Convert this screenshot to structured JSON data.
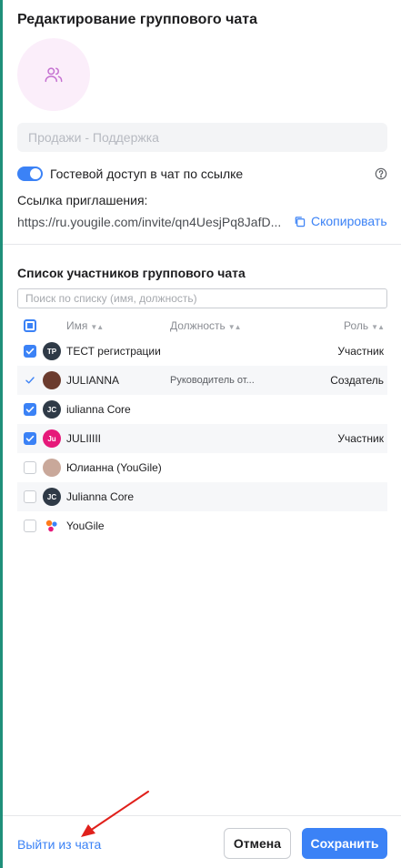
{
  "dialog": {
    "title": "Редактирование группового чата",
    "name_placeholder": "Продажи - Поддержка",
    "name_value": "",
    "guest_access_label": "Гостевой доступ в чат по ссылке",
    "guest_access_enabled": true,
    "invite_label": "Ссылка приглашения:",
    "invite_link": "https://ru.yougile.com/invite/qn4UesjPq8JafD...",
    "copy_label": "Скопировать"
  },
  "members": {
    "title": "Список участников группового чата",
    "search_placeholder": "Поиск по списку (имя, должность)",
    "columns": {
      "name": "Имя",
      "job": "Должность",
      "role": "Роль"
    },
    "rows": [
      {
        "check": "on",
        "avatar_text": "ТР",
        "avatar_color": "#2f3a47",
        "name": "ТЕСТ регистрации",
        "job": "",
        "role": "Участник"
      },
      {
        "check": "tick",
        "avatar_text": "",
        "avatar_color": "#6b3b2e",
        "name": "JULIANNA",
        "job": "Руководитель от...",
        "role": "Создатель"
      },
      {
        "check": "on",
        "avatar_text": "JC",
        "avatar_color": "#2f3a47",
        "name": "iulianna Core",
        "job": "",
        "role": ""
      },
      {
        "check": "on",
        "avatar_text": "Ju",
        "avatar_color": "#e6197a",
        "name": "JULIIIII",
        "job": "",
        "role": "Участник"
      },
      {
        "check": "off",
        "avatar_text": "",
        "avatar_color": "#c9a89a",
        "name": "Юлианна (YouGile)",
        "job": "",
        "role": ""
      },
      {
        "check": "off",
        "avatar_text": "JC",
        "avatar_color": "#2f3a47",
        "name": "Julianna Core",
        "job": "",
        "role": ""
      },
      {
        "check": "off",
        "avatar_text": "",
        "avatar_color": "#ffffff",
        "name": "YouGile",
        "job": "",
        "role": ""
      }
    ]
  },
  "footer": {
    "leave_label": "Выйти из чата",
    "cancel_label": "Отмена",
    "save_label": "Сохранить"
  },
  "colors": {
    "accent": "#3b82f6",
    "avatar_bg": "#fbeefa",
    "annotation_arrow": "#e0201b"
  }
}
